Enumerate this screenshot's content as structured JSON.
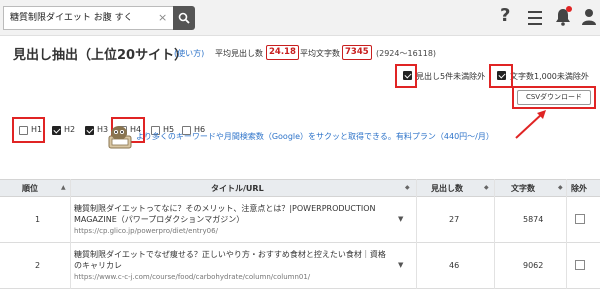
{
  "search": {
    "value": "糖質制限ダイエット お腹 すく",
    "clear": "×"
  },
  "header_icons": {
    "help": "?"
  },
  "page": {
    "title": "見出し抽出（上位20サイト）",
    "usage_link": "(使い方)",
    "avg_headings_label": "平均見出し数",
    "avg_headings_value": "24.18",
    "avg_chars_label": "平均文字数",
    "avg_chars_value": "7345",
    "range": "(2924〜16118)"
  },
  "filters": {
    "exclude_headings": {
      "label": "見出し5件未満除外",
      "checked": true
    },
    "exclude_chars": {
      "label": "文字数1,000未満除外",
      "checked": true
    },
    "csv_button": "CSVダウンロード",
    "levels": [
      {
        "label": "H1",
        "checked": false
      },
      {
        "label": "H2",
        "checked": true
      },
      {
        "label": "H3",
        "checked": true
      },
      {
        "label": "H4",
        "checked": false
      },
      {
        "label": "H5",
        "checked": false
      },
      {
        "label": "H6",
        "checked": false
      }
    ]
  },
  "promo": {
    "text": "より多くのキーワードや月間検索数（Google）をサクッと取得できる。有料プラン（440円〜/月）"
  },
  "table": {
    "columns": {
      "rank": "順位",
      "title_url": "タイトル/URL",
      "headings": "見出し数",
      "chars": "文字数",
      "exclude": "除外"
    },
    "rows": [
      {
        "rank": "1",
        "title": "糖質制限ダイエットってなに？そのメリット、注意点とは？|POWERPRODUCTION MAGAZINE（パワープロダクションマガジン）",
        "url": "https://cp.glico.jp/powerpro/diet/entry06/",
        "headings": "27",
        "chars": "5874"
      },
      {
        "rank": "2",
        "title": "糖質制限ダイエットでなぜ痩せる？正しいやり方・おすすめ食材と控えたい食材｜資格のキャリカレ",
        "url": "https://www.c-c-j.com/course/food/carbohydrate/column/column01/",
        "headings": "46",
        "chars": "9062"
      }
    ]
  },
  "colors": {
    "accent_red": "#e02424",
    "link_blue": "#2d73c9",
    "header_bg": "#f2f2f2"
  }
}
